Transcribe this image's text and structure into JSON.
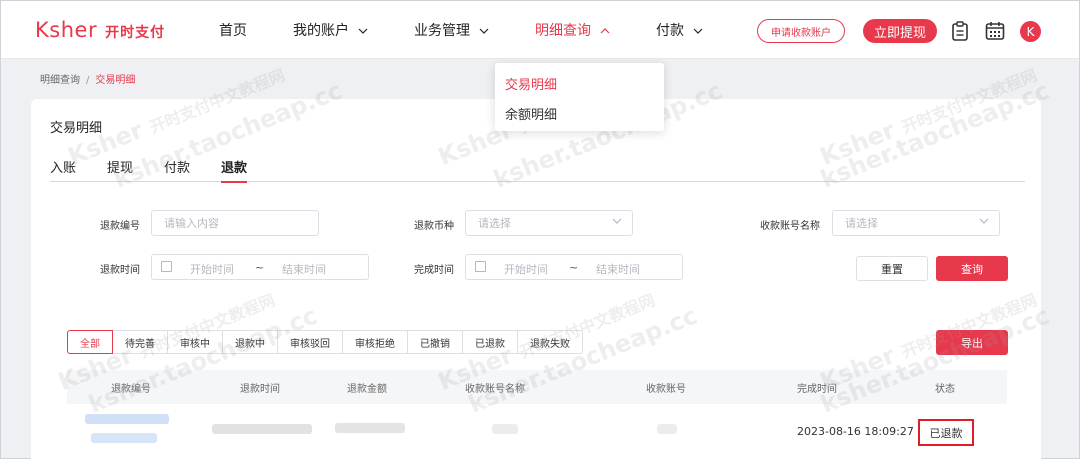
{
  "header": {
    "logo_mark": "Ksher",
    "logo_sub": "开时支付",
    "nav": [
      {
        "label": "首页",
        "has_menu": false,
        "active": false
      },
      {
        "label": "我的账户",
        "has_menu": true,
        "active": false
      },
      {
        "label": "业务管理",
        "has_menu": true,
        "active": false
      },
      {
        "label": "明细查询",
        "has_menu": true,
        "active": true
      },
      {
        "label": "付款",
        "has_menu": true,
        "active": false
      }
    ],
    "apply_account_label": "申请收款账户",
    "withdraw_label": "立即提现",
    "avatar_letter": "K",
    "icons": [
      "clipboard-icon",
      "calendar-icon"
    ]
  },
  "dropdown": {
    "items": [
      {
        "label": "交易明细",
        "active": true
      },
      {
        "label": "余额明细",
        "active": false
      }
    ]
  },
  "breadcrumb": {
    "parent": "明细查询",
    "separator": "/",
    "current": "交易明细"
  },
  "card": {
    "title": "交易明细",
    "tabs": [
      {
        "label": "入账",
        "active": false
      },
      {
        "label": "提现",
        "active": false
      },
      {
        "label": "付款",
        "active": false
      },
      {
        "label": "退款",
        "active": true
      }
    ]
  },
  "filters": {
    "refund_no_label": "退款编号",
    "refund_no_placeholder": "请输入内容",
    "currency_label": "退款币种",
    "currency_placeholder": "请选择",
    "account_name_label": "收款账号名称",
    "account_name_placeholder": "请选择",
    "refund_time_label": "退款时间",
    "finish_time_label": "完成时间",
    "start_placeholder": "开始时间",
    "range_sep": "~",
    "end_placeholder": "结束时间",
    "reset_label": "重置",
    "query_label": "查询"
  },
  "status_tabs": [
    {
      "label": "全部",
      "active": true
    },
    {
      "label": "待完善",
      "active": false
    },
    {
      "label": "审核中",
      "active": false
    },
    {
      "label": "退款中",
      "active": false
    },
    {
      "label": "审核驳回",
      "active": false
    },
    {
      "label": "审核拒绝",
      "active": false
    },
    {
      "label": "已撤销",
      "active": false
    },
    {
      "label": "已退款",
      "active": false
    },
    {
      "label": "退款失败",
      "active": false
    }
  ],
  "export_label": "导出",
  "table": {
    "columns": [
      "退款编号",
      "退款时间",
      "退款金额",
      "收款账号名称",
      "收款账号",
      "完成时间",
      "状态"
    ],
    "rows": [
      {
        "finish_time": "2023-08-16 18:09:27",
        "status": "已退款"
      }
    ]
  },
  "watermark": {
    "brand": "Ksher",
    "cn": "开时支付中文教程网",
    "site": "ksher.taocheap.cc"
  },
  "colors": {
    "accent": "#e8384c",
    "highlight_box": "#e01c24",
    "page_bg": "#eef0f3"
  }
}
